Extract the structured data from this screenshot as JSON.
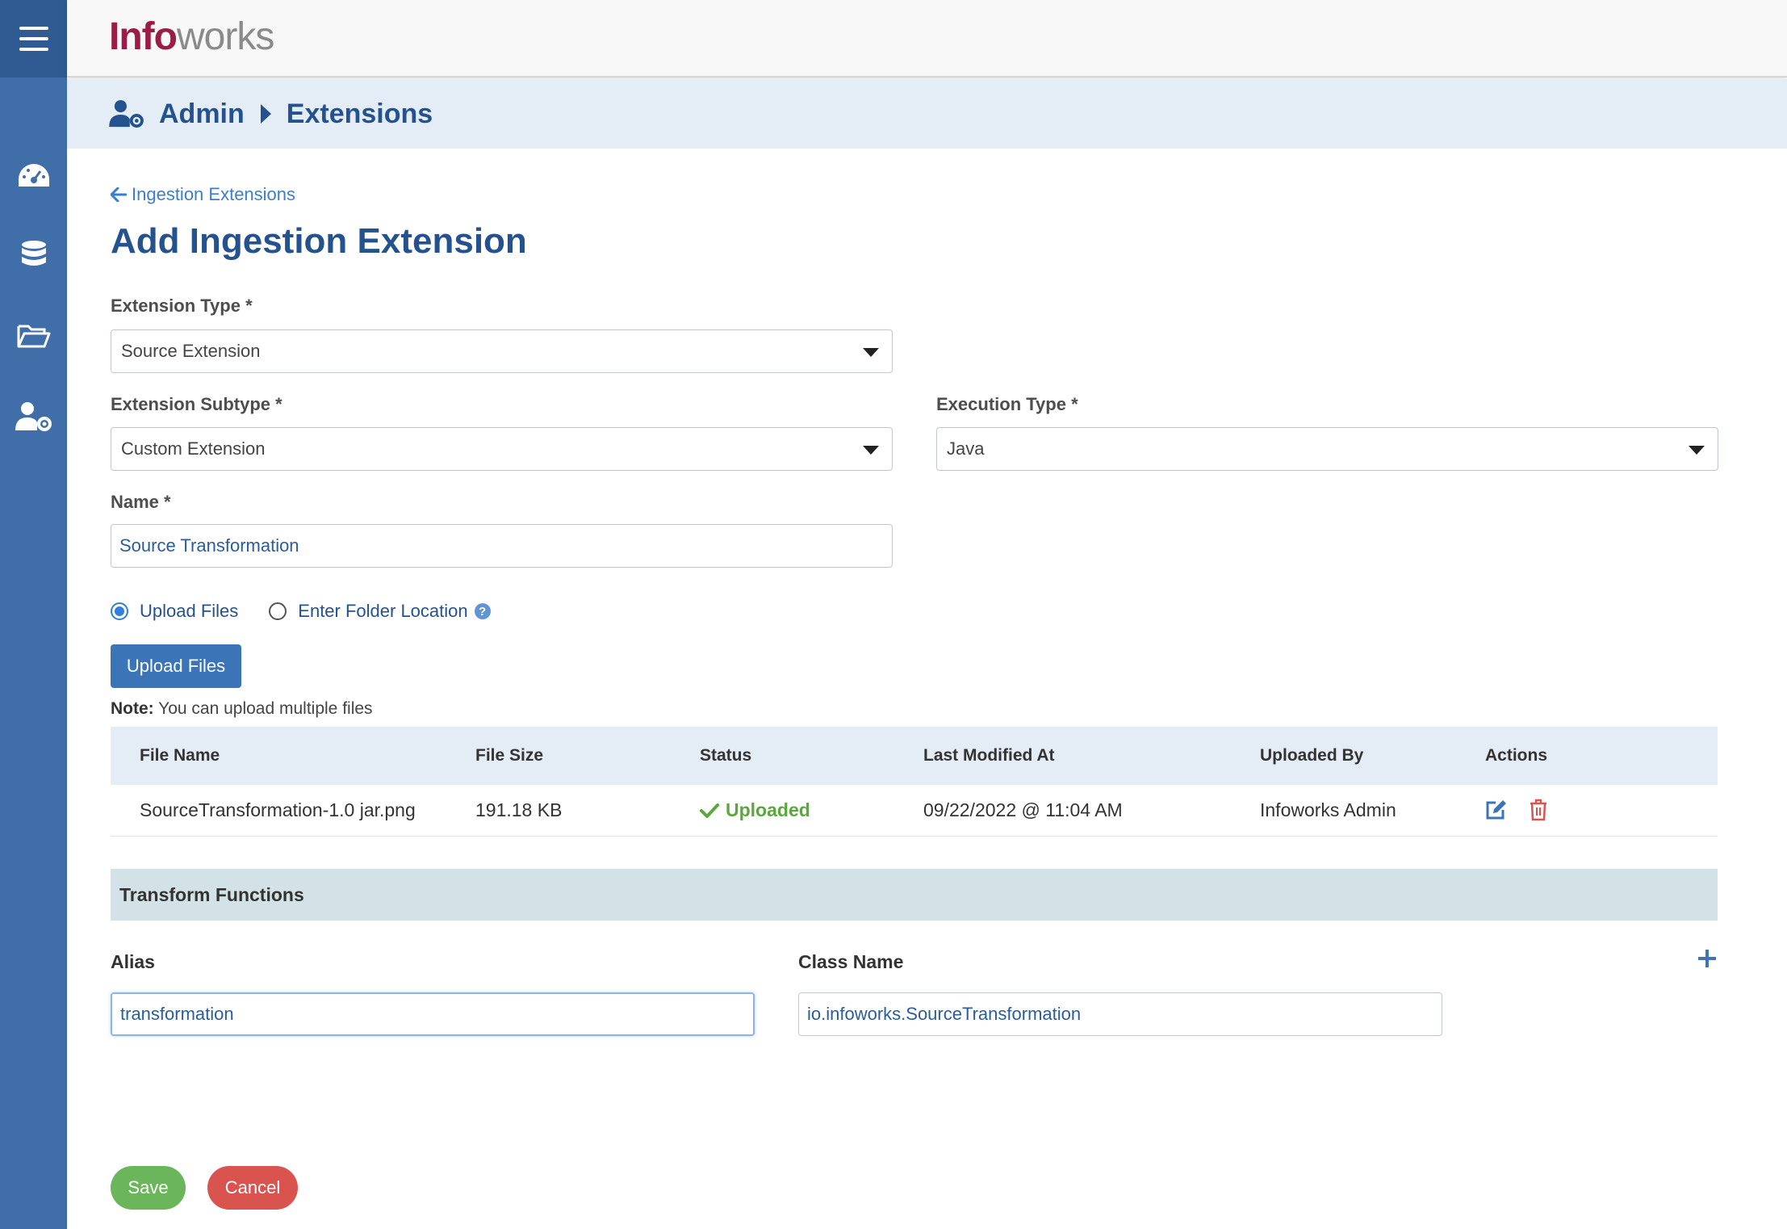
{
  "app": {
    "logo_part1": "Info",
    "logo_part2": "works"
  },
  "sidebar": {
    "items": [
      {
        "icon": "dashboard-icon"
      },
      {
        "icon": "database-icon"
      },
      {
        "icon": "folder-open-icon"
      },
      {
        "icon": "admin-user-gear-icon"
      }
    ]
  },
  "breadcrumb": {
    "root": "Admin",
    "current": "Extensions"
  },
  "back_link": "Ingestion Extensions",
  "page_title": "Add Ingestion Extension",
  "form": {
    "extension_type": {
      "label": "Extension Type *",
      "value": "Source Extension"
    },
    "extension_subtype": {
      "label": "Extension Subtype *",
      "value": "Custom Extension"
    },
    "execution_type": {
      "label": "Execution Type *",
      "value": "Java"
    },
    "name": {
      "label": "Name *",
      "value": "Source Transformation"
    },
    "source_mode": {
      "option_upload": "Upload Files",
      "option_folder": "Enter Folder Location",
      "selected": "Upload Files"
    },
    "upload_button": "Upload Files",
    "note_label": "Note:",
    "note_text": "You can upload multiple files"
  },
  "files_table": {
    "headers": [
      "File Name",
      "File Size",
      "Status",
      "Last Modified At",
      "Uploaded By",
      "Actions"
    ],
    "rows": [
      {
        "file_name": "SourceTransformation-1.0 jar.png",
        "file_size": "191.18 KB",
        "status": "Uploaded",
        "last_modified": "09/22/2022 @ 11:04 AM",
        "uploaded_by": "Infoworks Admin"
      }
    ]
  },
  "transform_functions": {
    "title": "Transform Functions",
    "alias_label": "Alias",
    "class_label": "Class Name",
    "rows": [
      {
        "alias": "transformation",
        "class_name": "io.infoworks.SourceTransformation"
      }
    ]
  },
  "actions": {
    "save": "Save",
    "cancel": "Cancel"
  },
  "colors": {
    "sidebar": "#3f6ea8",
    "primary": "#24528e",
    "success": "#6bb55a",
    "danger": "#d9534f",
    "brand": "#9b1c47"
  }
}
